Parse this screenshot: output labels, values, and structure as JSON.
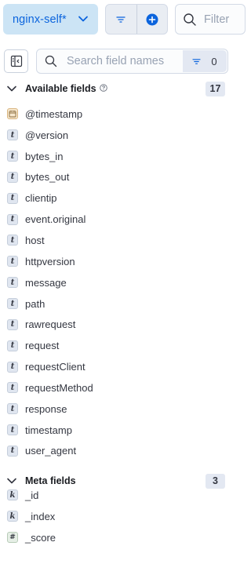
{
  "header": {
    "dataview_label": "nginx-self*",
    "filter_placeholder": "Filter"
  },
  "field_search": {
    "placeholder": "Search field names",
    "filter_count": "0"
  },
  "available_fields": {
    "title": "Available fields",
    "count": "17",
    "items": [
      {
        "type": "date",
        "token": "",
        "name": "@timestamp"
      },
      {
        "type": "text",
        "token": "t",
        "name": "@version"
      },
      {
        "type": "text",
        "token": "t",
        "name": "bytes_in"
      },
      {
        "type": "text",
        "token": "t",
        "name": "bytes_out"
      },
      {
        "type": "text",
        "token": "t",
        "name": "clientip"
      },
      {
        "type": "text",
        "token": "t",
        "name": "event.original"
      },
      {
        "type": "text",
        "token": "t",
        "name": "host"
      },
      {
        "type": "text",
        "token": "t",
        "name": "httpversion"
      },
      {
        "type": "text",
        "token": "t",
        "name": "message"
      },
      {
        "type": "text",
        "token": "t",
        "name": "path"
      },
      {
        "type": "text",
        "token": "t",
        "name": "rawrequest"
      },
      {
        "type": "text",
        "token": "t",
        "name": "request"
      },
      {
        "type": "text",
        "token": "t",
        "name": "requestClient"
      },
      {
        "type": "text",
        "token": "t",
        "name": "requestMethod"
      },
      {
        "type": "text",
        "token": "t",
        "name": "response"
      },
      {
        "type": "text",
        "token": "t",
        "name": "timestamp"
      },
      {
        "type": "text",
        "token": "t",
        "name": "user_agent"
      }
    ]
  },
  "meta_fields": {
    "title": "Meta fields",
    "count": "3",
    "items": [
      {
        "type": "keyword",
        "token": "k",
        "name": "_id"
      },
      {
        "type": "keyword",
        "token": "k",
        "name": "_index"
      },
      {
        "type": "number",
        "token": "#",
        "name": "_score"
      }
    ]
  },
  "colors": {
    "accent": "#0b64dd",
    "dataview_bg": "#cce4f5",
    "badge_bg": "#e3e8f2"
  },
  "icons": {
    "dataview_chevron": "chevron-down-icon",
    "filter_menu": "filter-lines-icon",
    "add": "plus-circle-icon",
    "filter_search": "search-icon",
    "sidebar": "sidebar-collapse-icon",
    "section_chevron": "chevron-down-icon",
    "help": "question-circle-icon",
    "date_field": "calendar-icon"
  }
}
